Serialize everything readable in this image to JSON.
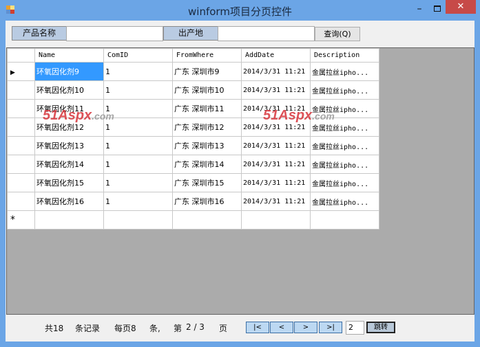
{
  "window": {
    "title": "winform项目分页控件",
    "min": "–",
    "close": "✕"
  },
  "search": {
    "name_label": "产品名称",
    "name_value": "",
    "origin_label": "出产地",
    "origin_value": "",
    "query_button": "查询(Q)"
  },
  "grid": {
    "columns": [
      "Name",
      "ComID",
      "FromWhere",
      "AddDate",
      "Description"
    ],
    "rows": [
      [
        "环氧因化剂9",
        "1",
        "广东 深圳市9",
        "2014/3/31 11:21",
        "金属拉丝ipho..."
      ],
      [
        "环氧因化剂10",
        "1",
        "广东 深圳市10",
        "2014/3/31 11:21",
        "金属拉丝ipho..."
      ],
      [
        "环氧因化剂11",
        "1",
        "广东 深圳市11",
        "2014/3/31 11:21",
        "金属拉丝ipho..."
      ],
      [
        "环氧因化剂12",
        "1",
        "广东 深圳市12",
        "2014/3/31 11:21",
        "金属拉丝ipho..."
      ],
      [
        "环氧因化剂13",
        "1",
        "广东 深圳市13",
        "2014/3/31 11:21",
        "金属拉丝ipho..."
      ],
      [
        "环氧因化剂14",
        "1",
        "广东 深圳市14",
        "2014/3/31 11:21",
        "金属拉丝ipho..."
      ],
      [
        "环氧因化剂15",
        "1",
        "广东 深圳市15",
        "2014/3/31 11:21",
        "金属拉丝ipho..."
      ],
      [
        "环氧因化剂16",
        "1",
        "广东 深圳市16",
        "2014/3/31 11:21",
        "金属拉丝ipho..."
      ]
    ],
    "current_marker": "▶",
    "new_row_marker": "*"
  },
  "watermark": "51Aspx.com",
  "pager": {
    "total": "共18",
    "records": "条记录",
    "per_page": "每页8",
    "tiao": "条,",
    "page_prefix": "第",
    "page_info": "2 / 3",
    "page_suffix": "页",
    "first": "|<",
    "prev": "<",
    "next": ">",
    "last": ">|",
    "page_input": "2",
    "go": "跳转"
  }
}
